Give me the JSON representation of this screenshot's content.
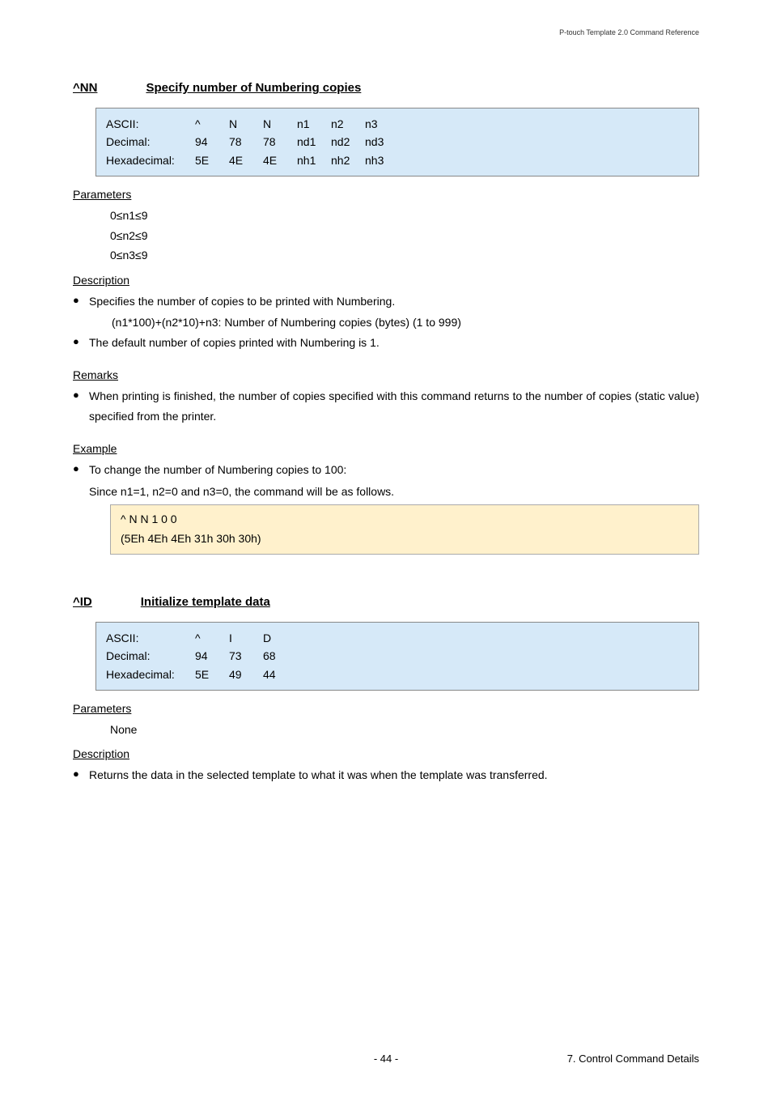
{
  "header": {
    "doc_title": "P-touch Template 2.0 Command Reference"
  },
  "section_nn": {
    "cmd": "^NN",
    "title": "Specify number of Numbering copies",
    "table": {
      "ascii": {
        "label": "ASCII:",
        "vals": [
          "^",
          "N",
          "N",
          "n1",
          "n2",
          "n3"
        ]
      },
      "decimal": {
        "label": "Decimal:",
        "vals": [
          "94",
          "78",
          "78",
          "nd1",
          "nd2",
          "nd3"
        ]
      },
      "hex": {
        "label": "Hexadecimal:",
        "vals": [
          "5E",
          "4E",
          "4E",
          "nh1",
          "nh2",
          "nh3"
        ]
      }
    },
    "parameters_label": "Parameters",
    "params": [
      "0≤n1≤9",
      "0≤n2≤9",
      "0≤n3≤9"
    ],
    "description_label": "Description",
    "desc_bullets": [
      "Specifies the number of copies to be printed with Numbering.",
      "The default number of copies printed with Numbering is 1."
    ],
    "desc_sub": "(n1*100)+(n2*10)+n3:   Number of Numbering copies (bytes) (1 to 999)",
    "remarks_label": "Remarks",
    "remarks_bullet": "When printing is finished, the number of copies specified with this command returns to the number of copies (static value) specified from the printer.",
    "example_label": "Example",
    "example_bullet": "To change the number of Numbering copies to 100:",
    "example_since": "Since n1=1, n2=0 and n3=0, the command will be as follows.",
    "example_box": {
      "line1": "^ N N 1 0 0",
      "line2": "(5Eh 4Eh 4Eh 31h 30h 30h)"
    }
  },
  "section_id": {
    "cmd": "^ID",
    "title": "Initialize template data",
    "table": {
      "ascii": {
        "label": "ASCII:",
        "vals": [
          "^",
          "I",
          "D"
        ]
      },
      "decimal": {
        "label": "Decimal:",
        "vals": [
          "94",
          "73",
          "68"
        ]
      },
      "hex": {
        "label": "Hexadecimal:",
        "vals": [
          "5E",
          "49",
          "44"
        ]
      }
    },
    "parameters_label": "Parameters",
    "param_none": "None",
    "description_label": "Description",
    "desc_bullet": "Returns the data in the selected template to what it was when the template was transferred."
  },
  "footer": {
    "page": "- 44 -",
    "chapter": "7. Control Command Details"
  }
}
